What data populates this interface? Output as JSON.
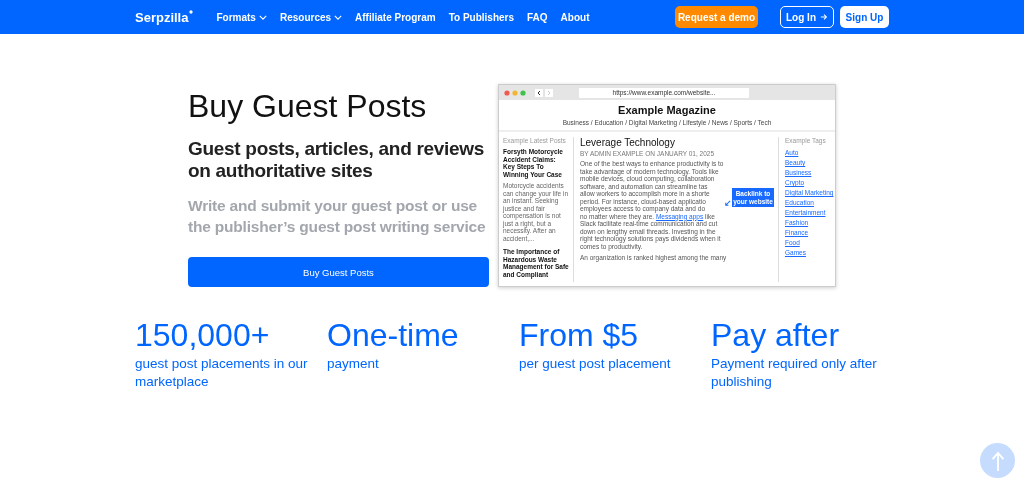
{
  "nav": {
    "logo": "Serpzilla",
    "items": [
      {
        "label": "Formats",
        "dropdown": true
      },
      {
        "label": "Resources",
        "dropdown": true
      },
      {
        "label": "Affiliate Program",
        "dropdown": false
      },
      {
        "label": "To Publishers",
        "dropdown": false
      },
      {
        "label": "FAQ",
        "dropdown": false
      },
      {
        "label": "About",
        "dropdown": false
      }
    ],
    "demo_button": "Request a demo",
    "login_button": "Log In",
    "signup_button": "Sign Up"
  },
  "hero": {
    "title": "Buy Guest Posts",
    "subtitle": "Guest posts, articles, and reviews on authoritative sites",
    "description": "Write and submit your guest post or use the publisher’s guest post writing service",
    "button": "Buy Guest Posts"
  },
  "mockup": {
    "url": "https://www.example.com/website...",
    "site_title": "Example Magazine",
    "categories": "Business / Education / Digital Marketing / Lifestyle / News  / Sports / Tech",
    "sidebar": {
      "heading": "Example Latest Posts",
      "posts": [
        {
          "title": "Forsyth Motorcycle Accident Claims: Key Steps To Winning Your Case",
          "excerpt": "Motorcycle accidents can change your life in an instant. Seeking justice and fair compensation is not just a right, but a necessity. After an accident,..."
        },
        {
          "title": "The Importance of Hazardous Waste Management for Safe and Compliant"
        }
      ]
    },
    "article": {
      "title": "Leverage Technology",
      "byline": "BY ADMIN EXAMPLE ON JANUARY 01, 2025",
      "lines_top": [
        "One of the best ways to enhance productivity is to",
        "take advantage of modern technology. Tools like",
        "mobile devices, cloud computing, collaboration"
      ],
      "lines_beside_callout": [
        "software, and automation can streamline tas",
        "allow workers to accomplish more in a shorte",
        "period. For instance, cloud-based applicatio",
        "employees access to company data and do"
      ],
      "callout": "Backlink to your website",
      "link_line": {
        "before": "no matter where they are. ",
        "link": "Messaging apps",
        "after": " like"
      },
      "lines_bottom": [
        "Slack facilitate real-time communication and cut",
        "down on lengthy email threads. Investing in the",
        "right technology solutions pays dividends when it",
        "comes to productivity."
      ],
      "paragraph_2": "An organization is ranked highest among the many"
    },
    "tags": {
      "heading": "Example Tags",
      "items": [
        "Auto",
        "Beauty",
        "Business",
        "Crypto",
        "Digital Marketing",
        "Education",
        "Entertainment",
        "Fashion",
        "Finance",
        "Food",
        "Games"
      ]
    }
  },
  "stats": [
    {
      "value": "150,000+",
      "caption": "guest post placements in our marketplace"
    },
    {
      "value": "One-time",
      "caption": "payment"
    },
    {
      "value": "From $5",
      "caption": "per guest post placement"
    },
    {
      "value": "Pay after",
      "caption": "Payment required only after publishing"
    }
  ]
}
